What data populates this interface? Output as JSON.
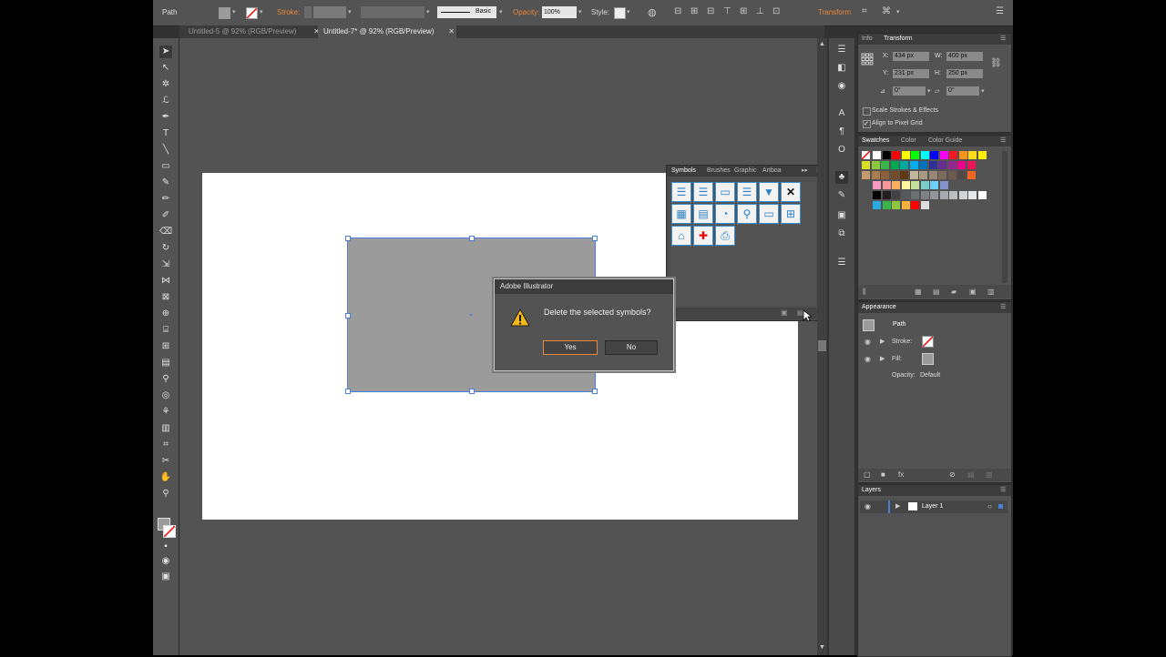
{
  "control_bar": {
    "selection_type": "Path",
    "stroke_label": "Stroke:",
    "stroke_profile": "Basic",
    "opacity_label": "Opacity:",
    "opacity_value": "100%",
    "style_label": "Style:",
    "transform_label": "Transform"
  },
  "tabs": [
    {
      "label": "Untitled-5 @ 92% (RGB/Preview)"
    },
    {
      "label": "Untitled-7* @ 92% (RGB/Preview)"
    }
  ],
  "transform_panel": {
    "tabs": [
      "Info",
      "Transform"
    ],
    "x_label": "X:",
    "x_value": "434 px",
    "y_label": "Y:",
    "y_value": "231 px",
    "w_label": "W:",
    "w_value": "400 px",
    "h_label": "H:",
    "h_value": "250 px",
    "angle_value": "0°",
    "shear_value": "0°",
    "scale_strokes": "Scale Strokes & Effects",
    "align_pixel": "Align to Pixel Grid"
  },
  "swatches_panel": {
    "tabs": [
      "Swatches",
      "Color",
      "Color Guide"
    ],
    "row1": [
      "#ffffff",
      "#000000",
      "#ff0000",
      "#ffff00",
      "#00ff00",
      "#00ffff",
      "#0000ff",
      "#ff00ff",
      "#ed1c24",
      "#f7941d",
      "#ffde17",
      "#fff200"
    ],
    "row2": [
      "#d7df23",
      "#8dc63f",
      "#39b54a",
      "#00a651",
      "#00a99d",
      "#00aeef",
      "#0072bc",
      "#2e3192",
      "#662d91",
      "#92278f",
      "#ec008c",
      "#ed145b"
    ],
    "row3": [
      "#c49a6c",
      "#a97c50",
      "#8b5e3c",
      "#754c29",
      "#603913",
      "#c2b59b",
      "#a79a7f",
      "#998675",
      "#7d6b5d",
      "#6d5b4e",
      "#534741",
      "#f26522"
    ],
    "row4": [
      "#f49ac1",
      "#f5989d",
      "#fbaf5d",
      "#fff799",
      "#c4df9b",
      "#7accc8",
      "#6dcff6",
      "#8393ca"
    ],
    "row5": [
      "#000000",
      "#231f20",
      "#414042",
      "#58595b",
      "#6d6e71",
      "#808285",
      "#939598",
      "#a7a9ac",
      "#bcbec0",
      "#d1d3d4",
      "#e6e7e8",
      "#ffffff"
    ],
    "row6": [
      "#29abe2",
      "#39b54a",
      "#8cc63f",
      "#fbb03b",
      "#ff0000",
      "#dddddd"
    ]
  },
  "symbols_panel": {
    "tabs": [
      "Symbols",
      "Brushes",
      "Graphic",
      "Artboa"
    ]
  },
  "appearance_panel": {
    "title": "Appearance",
    "object": "Path",
    "stroke_label": "Stroke:",
    "fill_label": "Fill:",
    "opacity_label": "Opacity:",
    "opacity_value": "Default"
  },
  "layers_panel": {
    "title": "Layers",
    "layer_name": "Layer 1"
  },
  "dialog": {
    "title": "Adobe Illustrator",
    "message": "Delete the selected symbols?",
    "yes": "Yes",
    "no": "No"
  },
  "colors": {
    "accent_orange": "#e8863a",
    "selection_blue": "#4a7fd6",
    "symbol_blue": "#2a82c6"
  }
}
